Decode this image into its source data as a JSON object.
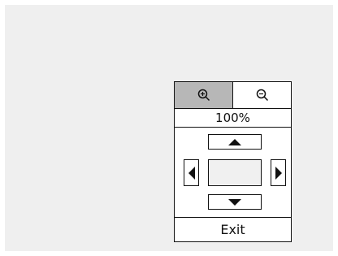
{
  "zoom": {
    "zoom_in_icon": "magnifier-plus-icon",
    "zoom_out_icon": "magnifier-minus-icon",
    "level": "100%"
  },
  "pan": {
    "up_icon": "triangle-up-icon",
    "down_icon": "triangle-down-icon",
    "left_icon": "triangle-left-icon",
    "right_icon": "triangle-right-icon"
  },
  "exit_label": "Exit",
  "colors": {
    "background": "#efefef",
    "panel": "#ffffff",
    "selected": "#b7b7b7",
    "border": "#111111"
  }
}
